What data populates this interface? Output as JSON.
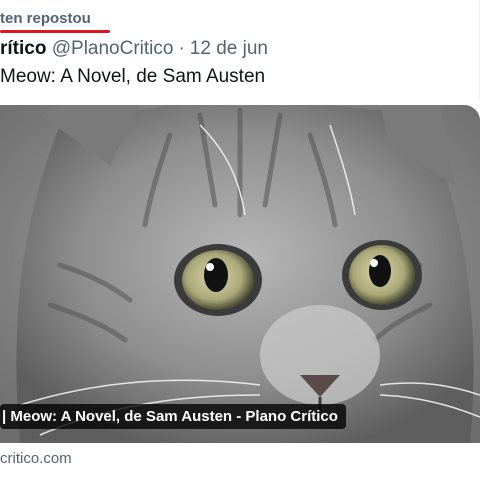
{
  "repost": {
    "label": "ten repostou"
  },
  "author": {
    "name": "rítico",
    "handle": "@PlanoCritico",
    "separator": "·",
    "date": "12 de jun"
  },
  "post": {
    "text": "Meow: A Novel, de Sam Austen"
  },
  "card": {
    "title": "| Meow: A Novel, de Sam Austen - Plano Crítico",
    "domain": "critico.com"
  }
}
